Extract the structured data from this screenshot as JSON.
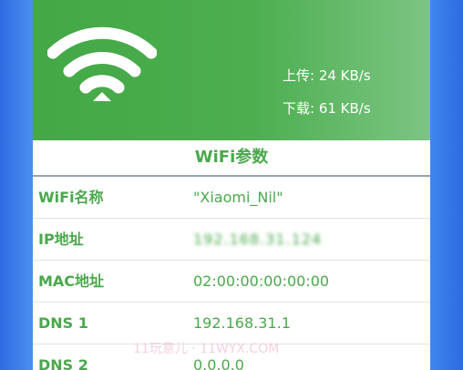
{
  "header": {
    "upload_label": "上传: 24 KB/s",
    "download_label": "下载: 61 KB/s"
  },
  "section": {
    "title": "WiFi参数"
  },
  "params": [
    {
      "label": "WiFi名称",
      "value": "\"Xiaomi_Nil\""
    },
    {
      "label": "IP地址",
      "value": "192.168.31.124"
    },
    {
      "label": "MAC地址",
      "value": "02:00:00:00:00:00"
    },
    {
      "label": "DNS 1",
      "value": "192.168.31.1"
    },
    {
      "label": "DNS 2",
      "value": "0.0.0.0"
    }
  ],
  "watermark": "11玩意儿 · 11WYX.COM",
  "colors": {
    "accent_green": "#4aa84c",
    "background_blue": "#3b82f0"
  },
  "icons": {
    "wifi": "wifi-icon"
  }
}
